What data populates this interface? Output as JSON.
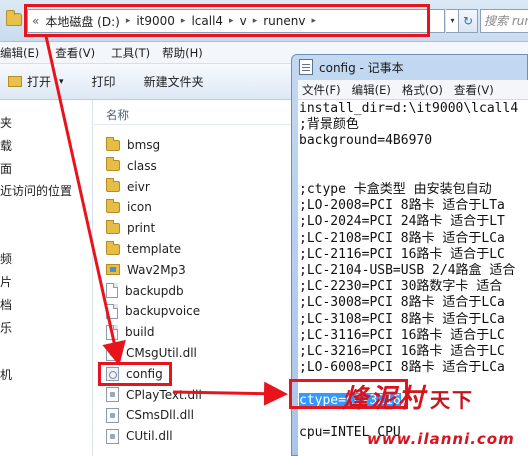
{
  "explorer": {
    "address": {
      "overflow": "«",
      "crumbs": [
        "本地磁盘 (D:)",
        "it9000",
        "lcall4",
        "v",
        "runenv"
      ],
      "sep": "▸",
      "dropdown": "▾",
      "refresh": "↻",
      "search_placeholder": "搜索 runenv"
    },
    "menus": [
      "编辑(E)",
      "查看(V)",
      "工具(T)",
      "帮助(H)"
    ],
    "toolbar": {
      "open_label": "打开",
      "open_arrow": "▾",
      "print_label": "打印",
      "new_folder_label": "新建文件夹"
    },
    "nav_items": [
      "夹",
      "载",
      "面",
      "近访问的位置",
      "",
      "频",
      "片",
      "档",
      "乐",
      "机"
    ],
    "column_header": "名称",
    "files": [
      {
        "name": "bmsg",
        "type": "folder"
      },
      {
        "name": "class",
        "type": "folder"
      },
      {
        "name": "eivr",
        "type": "folder"
      },
      {
        "name": "icon",
        "type": "folder"
      },
      {
        "name": "print",
        "type": "folder"
      },
      {
        "name": "template",
        "type": "folder"
      },
      {
        "name": "Wav2Mp3",
        "type": "folder"
      },
      {
        "name": "backupdb",
        "type": "file"
      },
      {
        "name": "backupvoice",
        "type": "file"
      },
      {
        "name": "build",
        "type": "file"
      },
      {
        "name": "CMsgUtil.dll",
        "type": "dll"
      },
      {
        "name": "config",
        "type": "config"
      },
      {
        "name": "CPlayText.dll",
        "type": "dll"
      },
      {
        "name": "CSmsDll.dll",
        "type": "dll"
      },
      {
        "name": "CUtil.dll",
        "type": "dll"
      }
    ]
  },
  "notepad": {
    "title": "config - 记事本",
    "menus": [
      "文件(F)",
      "编辑(E)",
      "格式(O)",
      "查看(V)"
    ],
    "lines": [
      "install_dir=d:\\it9000\\lcall4",
      ";背景颜色",
      "background=4B6970",
      "",
      "",
      ";ctype 卡盒类型 由安装包自动",
      ";LO-2008=PCI 8路卡 适合于LTa",
      ";LO-2024=PCI 24路卡 适合于LT",
      ";LC-2108=PCI 8路卡 适合于LCa",
      ";LC-2116=PCI 16路卡 适合于LC",
      ";LC-2104-USB=USB 2/4路盒 适合",
      ";LC-2230=PCI 30路数字卡 适合",
      ";LC-3008=PCI 8路卡 适合于LCa",
      ";LC-3108=PCI 8路卡 适合于LCa",
      ";LC-3116=PCI 16路卡 适合于LC",
      ";LC-3216=PCI 16路卡 适合于LC",
      ";LO-6008=PCI 8路卡 适合于LCa",
      "",
      "ctype=LC-3216",
      "",
      "cpu=INTEL CPU"
    ],
    "selected_line_index": 18
  },
  "watermark": {
    "logo": "烽泥村",
    "logo_small": "天下",
    "url": "www.ilanni.com"
  },
  "colors": {
    "annotation_red": "#e8141d",
    "selection_blue": "#3399ff",
    "explorer_chrome": "#dce9f6"
  }
}
